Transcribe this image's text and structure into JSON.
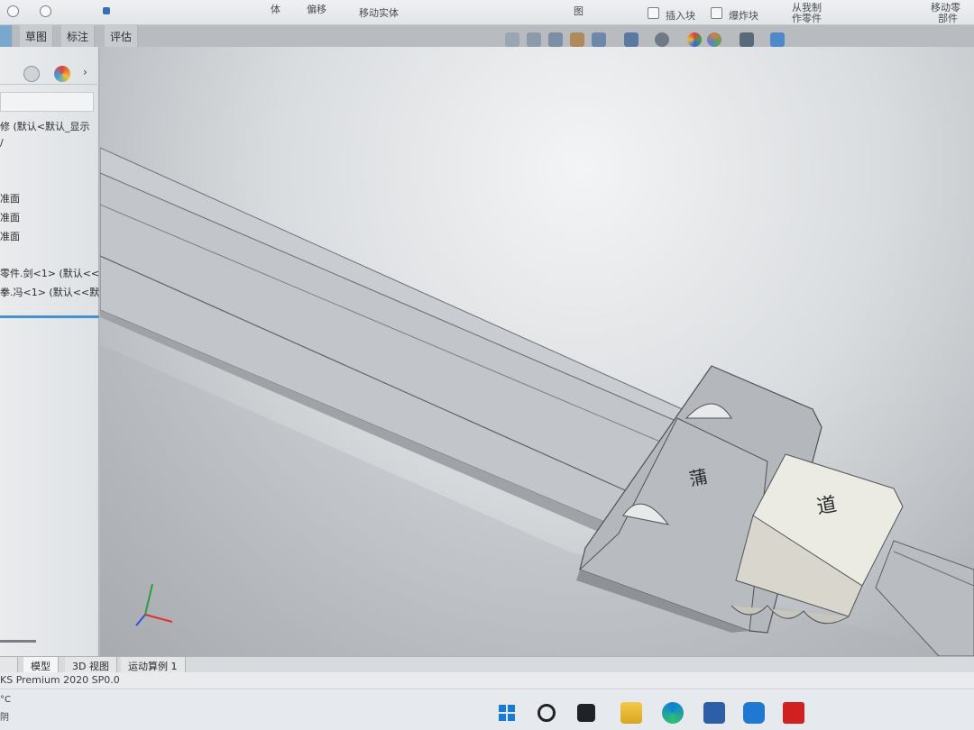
{
  "ribbon": {
    "item_body": "体",
    "item_offset": "偏移",
    "item_move_body": "移动实体",
    "item_drawing": "图",
    "item_insert_block": "插入块",
    "item_explode_block": "爆炸块",
    "item_from_drawing": "从我制",
    "item_make_part": "作零件",
    "item_move_zero": "移动零",
    "item_part": "部件"
  },
  "tabs": {
    "sketch": "草图",
    "annotate": "标注",
    "evaluate": "评估"
  },
  "tree": {
    "root": "修 (默认<默认_显示",
    "plane1": "准面",
    "plane2": "准面",
    "plane3": "准面",
    "part1": "零件.剑<1> (默认<<",
    "part2": "拳.冯<1> (默认<<默"
  },
  "viewport": {
    "engraving_guard": "蒲",
    "engraving_handle": "道",
    "colors": {
      "blade_top": "#c9ccd0",
      "blade_face": "#bfc2c6",
      "guard": "#b3b6ba",
      "handle_block": "#e9e6db",
      "triad_x": "#e03030",
      "triad_y": "#2aa040",
      "triad_z": "#3050e0"
    }
  },
  "bottom_tabs": {
    "model": "模型",
    "view3d": "3D 视图",
    "motion": "运动算例 1"
  },
  "status": {
    "version": "KS Premium 2020 SP0.0"
  },
  "taskbar": {
    "temp": "°C",
    "weather": "阴",
    "icons": [
      "windows-icon",
      "search-icon",
      "taskview-icon",
      "file-explorer-icon",
      "edge-icon",
      "store-icon",
      "app-icon",
      "solidworks-icon"
    ]
  }
}
